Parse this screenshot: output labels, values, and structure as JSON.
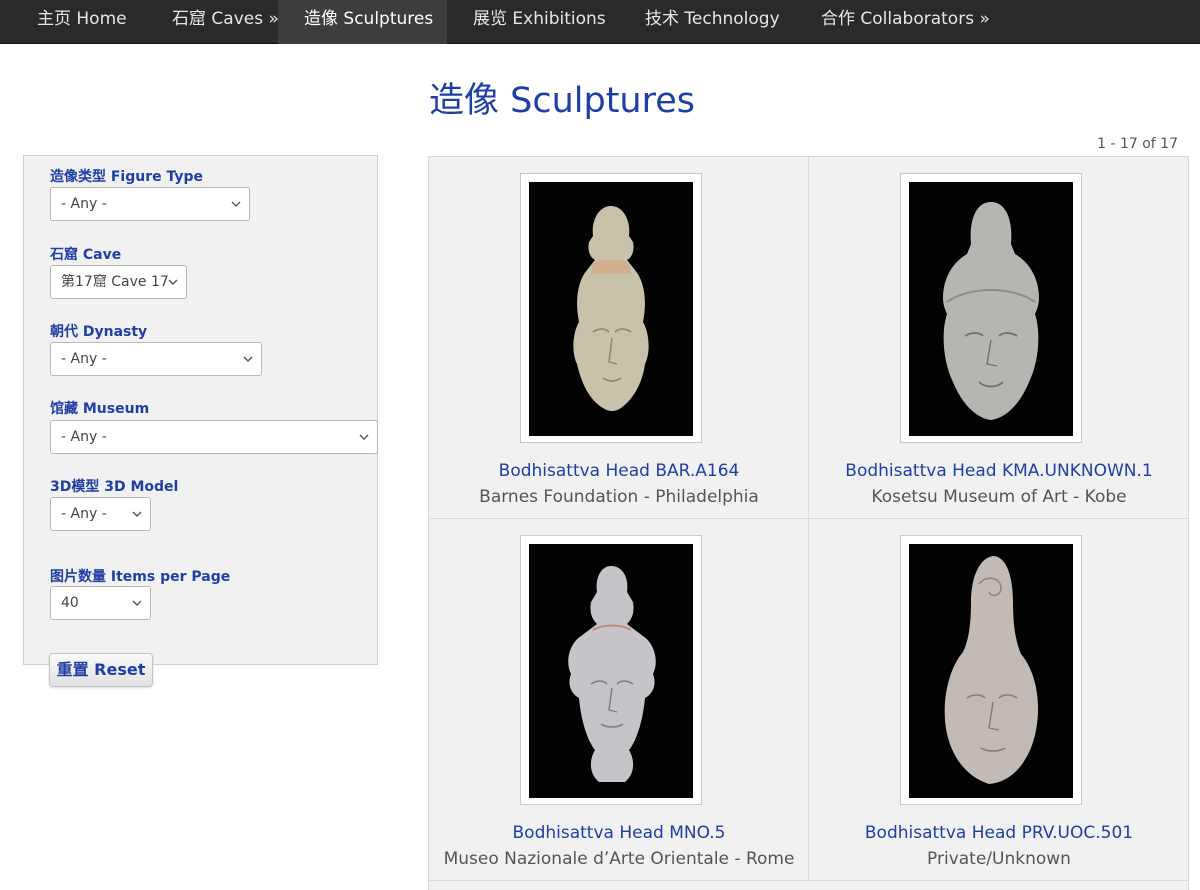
{
  "nav": {
    "items": [
      {
        "label": "主页 Home"
      },
      {
        "label": "石窟 Caves »"
      },
      {
        "label": "造像 Sculptures"
      },
      {
        "label": "展览 Exhibitions"
      },
      {
        "label": "技术 Technology"
      },
      {
        "label": "合作 Collaborators »"
      }
    ],
    "active_index": 2
  },
  "page": {
    "title": "造像 Sculptures",
    "summary": "1 - 17 of 17"
  },
  "filters": {
    "figure_type": {
      "label": "造像类型 Figure Type",
      "value": "- Any -"
    },
    "cave": {
      "label": "石窟 Cave",
      "value": "第17窟 Cave 17"
    },
    "dynasty": {
      "label": "朝代 Dynasty",
      "value": "- Any -"
    },
    "museum": {
      "label": "馆藏 Museum",
      "value": "- Any -"
    },
    "model": {
      "label": "3D模型 3D Model",
      "value": "- Any -"
    },
    "per_page": {
      "label": "图片数量 Items per Page",
      "value": "40"
    },
    "reset_label": "重置 Reset"
  },
  "results": [
    {
      "title": "Bodhisattva Head BAR.A164",
      "location": "Barnes Foundation - Philadelphia"
    },
    {
      "title": "Bodhisattva Head KMA.UNKNOWN.1",
      "location": "Kosetsu Museum of Art - Kobe"
    },
    {
      "title": "Bodhisattva Head MNO.5",
      "location": "Museo Nazionale d’Arte Orientale - Rome"
    },
    {
      "title": "Bodhisattva Head PRV.UOC.501",
      "location": "Private/Unknown"
    }
  ],
  "colors": {
    "link_blue": "#1f3fa6",
    "nav_bg": "#2a2a2a",
    "panel_bg": "#f1f1f1"
  }
}
